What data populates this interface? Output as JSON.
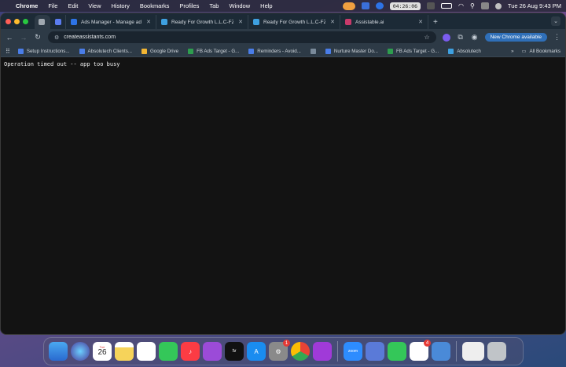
{
  "menubar": {
    "items": [
      "Chrome",
      "File",
      "Edit",
      "View",
      "History",
      "Bookmarks",
      "Profiles",
      "Tab",
      "Window",
      "Help"
    ],
    "timer": "04:26:06",
    "datetime": "Tue 26 Aug  9:43 PM"
  },
  "tabs": [
    {
      "title": "",
      "favicon": "cube-icon",
      "color": "#5b7cf0"
    },
    {
      "title": "Ads Manager - Manage ads",
      "favicon": "meta-icon",
      "color": "#2d73e6"
    },
    {
      "title": "Ready For Growth L.L.C-FZ",
      "favicon": "grid-icon",
      "color": "#3ea0e0"
    },
    {
      "title": "Ready For Growth L.L.C-FZ",
      "favicon": "grid-icon",
      "color": "#3ea0e0"
    },
    {
      "title": "Assistable.ai",
      "favicon": "assistable-icon",
      "color": "#c83a6a"
    }
  ],
  "toolbar": {
    "url": "createassistants.com",
    "new_chrome_label": "New Chrome available"
  },
  "bookmarks": {
    "items": [
      {
        "label": "Setup Instructions...",
        "color": "#4a7de8"
      },
      {
        "label": "Absolutech Clients...",
        "color": "#4a7de8"
      },
      {
        "label": "Google Drive",
        "color": "#f2b533"
      },
      {
        "label": "FB Ads Target - G...",
        "color": "#2e9d4e"
      },
      {
        "label": "Reminders - Avoid...",
        "color": "#4a7de8"
      },
      {
        "label": "",
        "color": "#7a8a9a"
      },
      {
        "label": "Nurture Master Do...",
        "color": "#4a7de8"
      },
      {
        "label": "FB Ads Target - G...",
        "color": "#2e9d4e"
      },
      {
        "label": "Absolutech",
        "color": "#3ea0e0"
      }
    ],
    "all_bookmarks_label": "All Bookmarks"
  },
  "content": {
    "message": "Operation timed out -- app too busy"
  },
  "dock": {
    "calendar_month": "Tue",
    "calendar_day": "26",
    "settings_badge": "1",
    "slack_badge": "4",
    "zoom_label": "zoom"
  }
}
